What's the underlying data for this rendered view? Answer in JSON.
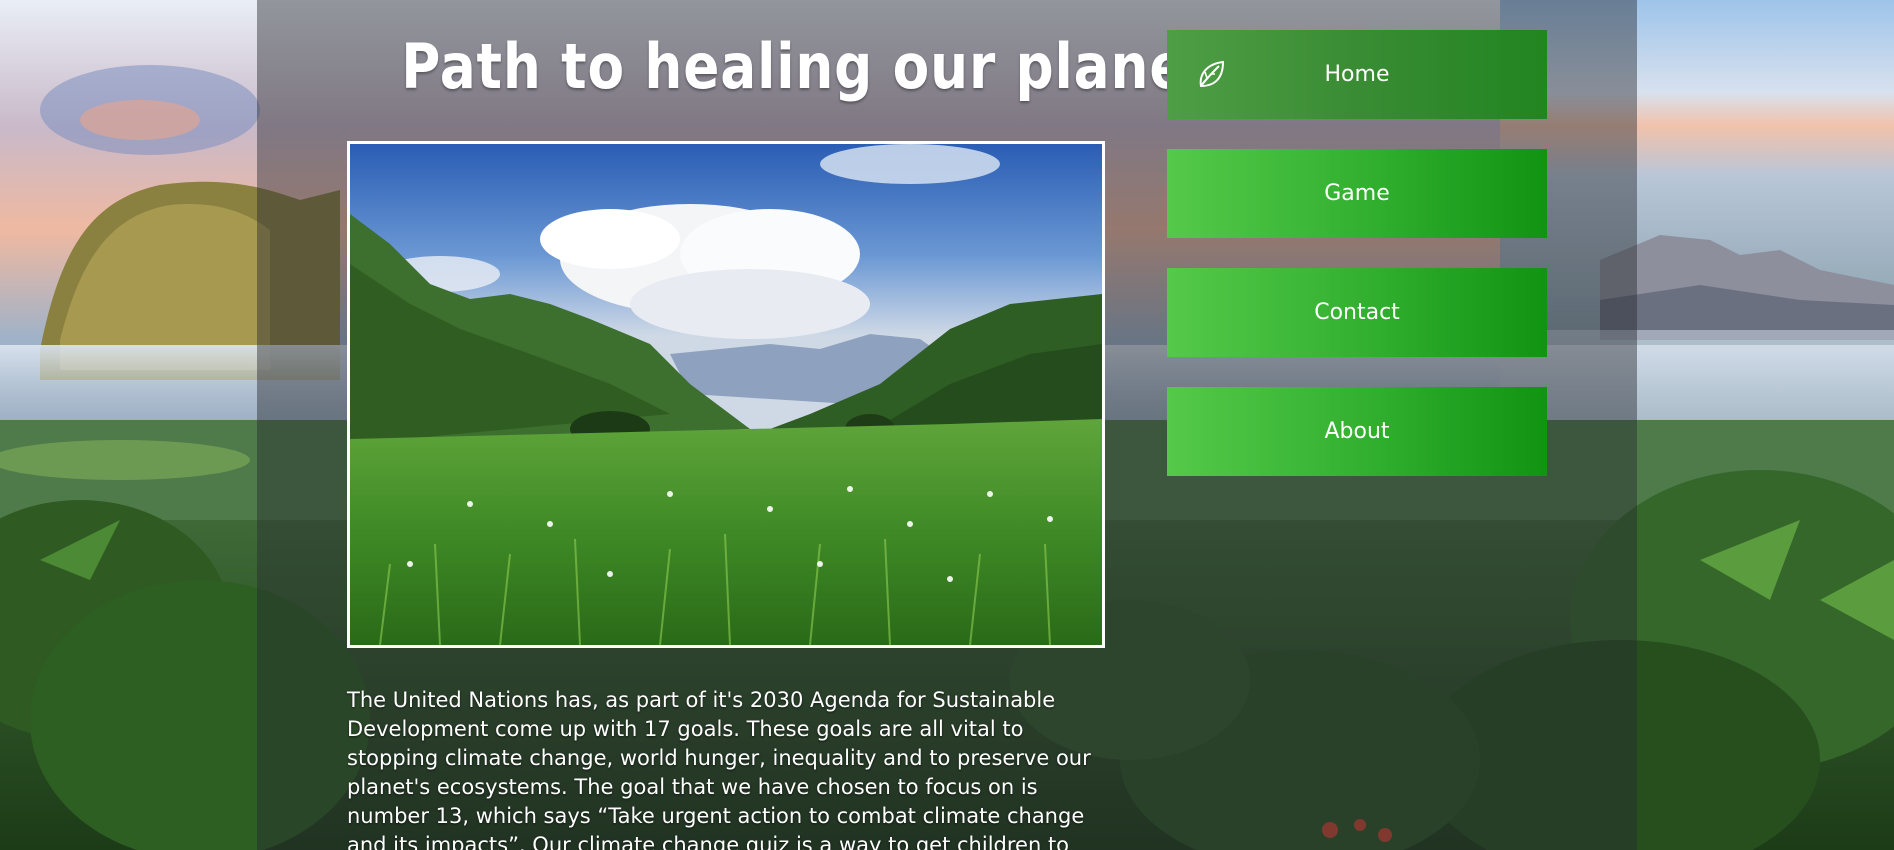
{
  "header": {
    "title": "Path to healing our planet"
  },
  "nav": {
    "items": [
      {
        "label": "Home",
        "icon": "leaf-icon",
        "active": true
      },
      {
        "label": "Game"
      },
      {
        "label": "Contact"
      },
      {
        "label": "About"
      }
    ]
  },
  "main": {
    "intro_lines": [
      "The United Nations has, as part of it's 2030 Agenda for Sustainable",
      "Development come up with 17 goals. These goals are all vital to",
      "stopping climate change, world hunger, inequality and to preserve our",
      "planet's ecosystems. The goal that we have chosen to focus on is",
      "number 13, which says “Take urgent action to combat climate change",
      "and its impacts”. Our climate change quiz is a way to get children to"
    ]
  },
  "colors": {
    "nav_green_light": "#55c94a",
    "nav_green_dark": "#119412",
    "panel_overlay": "#282a30"
  }
}
